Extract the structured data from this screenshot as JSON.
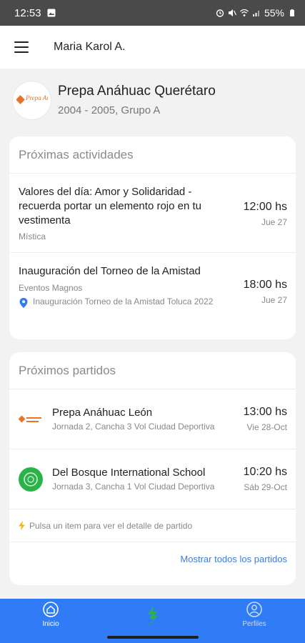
{
  "status_bar": {
    "time": "12:53",
    "battery": "55%"
  },
  "app_bar": {
    "user_name": "Maria Karol A."
  },
  "school": {
    "name": "Prepa Anáhuac Querétaro",
    "period": "2004 - 2005, Grupo A",
    "logo_text": "Prepa Anáhuac"
  },
  "activities": {
    "title": "Próximas actividades",
    "items": [
      {
        "name": "Valores del día: Amor y Solidaridad - recuerda portar un elemento rojo en tu vestimenta",
        "category": "Mística",
        "time": "12:00 hs",
        "date": "Jue 27"
      },
      {
        "name": "Inauguración del Torneo de la Amistad",
        "category": "Eventos Magnos",
        "location": "Inauguración Torneo de la Amistad Toluca 2022",
        "time": "18:00 hs",
        "date": "Jue 27"
      }
    ]
  },
  "matches": {
    "title": "Próximos partidos",
    "items": [
      {
        "team": "Prepa Anáhuac León",
        "detail": "Jornada 2, Cancha 3 Vol Ciudad Deportiva",
        "time": "13:00 hs",
        "date": "Vie 28-Oct"
      },
      {
        "team": "Del Bosque International School",
        "detail": "Jornada 3, Cancha 1 Vol Ciudad Deportiva",
        "time": "10:20 hs",
        "date": "Sáb 29-Oct"
      }
    ],
    "hint": "Pulsa un item para ver el detalle de partido",
    "show_all": "Mostrar todos los partidos"
  },
  "bottom_nav": {
    "inicio": "Inicio",
    "perfiles": "Perfiles"
  },
  "colors": {
    "accent": "#2f7cf6",
    "link": "#3b7de6",
    "logo_orange": "#e8742a",
    "school_green": "#2bb34a"
  }
}
